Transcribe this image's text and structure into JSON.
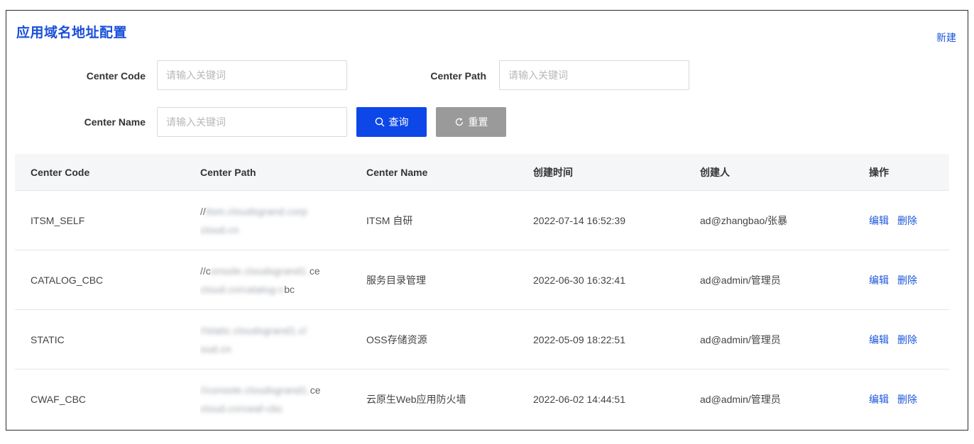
{
  "header": {
    "title": "应用域名地址配置",
    "new_label": "新建"
  },
  "filters": {
    "code_label": "Center Code",
    "path_label": "Center Path",
    "name_label": "Center Name",
    "placeholder": "请输入关键词",
    "search_label": "查询",
    "reset_label": "重置"
  },
  "table": {
    "columns": [
      "Center Code",
      "Center Path",
      "Center Name",
      "创建时间",
      "创建人",
      "操作"
    ],
    "actions": {
      "edit": "编辑",
      "delete": "删除"
    },
    "rows": [
      {
        "code": "ITSM_SELF",
        "path_line1_clear": "//",
        "path_line1_blur": "itsm.cloudsgrand.corp",
        "path_line1_tail": "",
        "path_line2_blur": "cloud.cn",
        "path_line2_tail": "",
        "name": "ITSM 自研",
        "created": "2022-07-14 16:52:39",
        "creator": "ad@zhangbao/张暴"
      },
      {
        "code": "CATALOG_CBC",
        "path_line1_clear": "//c",
        "path_line1_blur": "onsole.cloudsgrand1.",
        "path_line1_tail": "ce",
        "path_line2_blur": "cloud.cn/catalog-c",
        "path_line2_tail": "bc",
        "name": "服务目录管理",
        "created": "2022-06-30 16:32:41",
        "creator": "ad@admin/管理员"
      },
      {
        "code": "STATIC",
        "path_line1_clear": "",
        "path_line1_blur": "//static.cloudsgrand1.cl",
        "path_line1_tail": "",
        "path_line2_blur": "oud.cn",
        "path_line2_tail": "",
        "name": "OSS存储资源",
        "created": "2022-05-09 18:22:51",
        "creator": "ad@admin/管理员"
      },
      {
        "code": "CWAF_CBC",
        "path_line1_clear": "",
        "path_line1_blur": "//console.cloudsgrand1.",
        "path_line1_tail": "ce",
        "path_line2_blur": "cloud.cn/cwaf-cbc",
        "path_line2_tail": "",
        "name": "云原生Web应用防火墙",
        "created": "2022-06-02 14:44:51",
        "creator": "ad@admin/管理员"
      }
    ]
  },
  "icons": {
    "search": "search-icon",
    "reset": "refresh-icon"
  },
  "colors": {
    "accent": "#0d47e8",
    "link": "#1a56db",
    "reset_button": "#9a9a9a",
    "header_bg": "#f5f6f8"
  }
}
